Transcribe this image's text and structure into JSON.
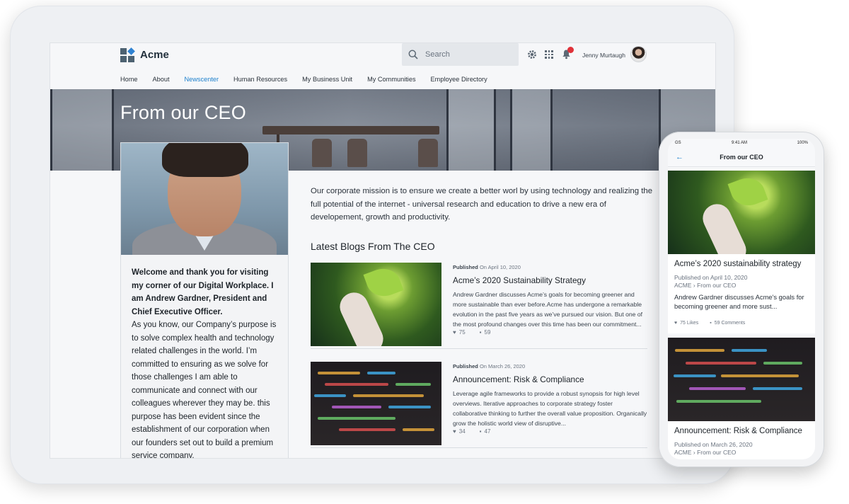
{
  "header": {
    "brand": "Acme",
    "search_placeholder": "Search",
    "user_name": "Jenny Murtaugh"
  },
  "nav": [
    {
      "label": "Home",
      "active": false
    },
    {
      "label": "About",
      "active": false
    },
    {
      "label": "Newscenter",
      "active": true
    },
    {
      "label": "Human Resources",
      "active": false
    },
    {
      "label": "My Business Unit",
      "active": false
    },
    {
      "label": "My Communities",
      "active": false
    },
    {
      "label": "Employee Directory",
      "active": false
    }
  ],
  "hero": {
    "title": "From our CEO"
  },
  "ceo": {
    "welcome": "Welcome and thank you for visiting my corner of our Digital Workplace.  I am Andrew Gardner, President and Chief Executive Officer.",
    "body": "As you know, our Company’s purpose is to solve complex health and technology related challenges in the world. I’m committed to ensuring as we solve for those challenges I am able to communicate and connect with our colleagues wherever they may be. this purpose has been evident since the establishment of our corporation when our founders set out to build a premium service company."
  },
  "mission": "Our corporate mission is to ensure we create a better worl by using technology and realizing the full potential of the internet - universal research and education to drive a new era of developement, growth and productivity.",
  "blogs": {
    "heading": "Latest Blogs From The CEO",
    "items": [
      {
        "published_label": "Published",
        "published_date": "On April 10, 2020",
        "title": "Acme’s 2020 Sustainability Strategy",
        "excerpt": "Andrew Gardner discusses Acme’s goals for becoming greener and more sustainable than ever before.Acme has undergone a remarkable evolution in the past five years as we’ve pursued our vision. But one of the most profound changes over this time has been our commitment...",
        "likes": "75",
        "comments": "59"
      },
      {
        "published_label": "Published",
        "published_date": "On March 26, 2020",
        "title": "Announcement: Risk & Compliance",
        "excerpt": "Leverage agile frameworks to provide a robust synopsis for high level overviews. Iterative approaches to corporate strategy foster collaborative thinking to further the overall value proposition. Organically grow the holistic world view of disruptive...",
        "likes": "34",
        "comments": "47"
      }
    ]
  },
  "phone": {
    "status_left": "GS",
    "status_time": "9:41 AM",
    "status_right": "100%",
    "header_title": "From our CEO",
    "cards": [
      {
        "title": "Acme’s 2020 sustainability strategy",
        "published": "Published on April 10, 2020",
        "breadcrumb": "ACME › From our CEO",
        "desc": "Andrew Gardner discusses Acme's goals for becoming greener and more sust...",
        "likes": "75 Likes",
        "comments": "59 Comments"
      },
      {
        "title": "Announcement: Risk & Compliance",
        "published": "Published on March 26, 2020",
        "breadcrumb": "ACME › From our CEO"
      }
    ]
  },
  "colors": {
    "accent": "#1b7fcc",
    "notification": "#e0323a"
  }
}
